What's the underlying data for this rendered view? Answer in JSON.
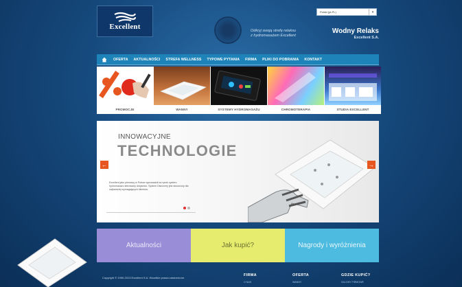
{
  "logo": {
    "text": "Excellent"
  },
  "language_select": {
    "value": "Polski (pl-PL)"
  },
  "tagline": {
    "line1": "Odkryj swoją strefę relaksu",
    "line2": "z hydromasażem Excellent"
  },
  "brand": {
    "title": "Wodny Relaks",
    "subtitle": "Excellent S.A."
  },
  "nav": {
    "items": [
      "OFERTA",
      "AKTUALNOŚCI",
      "STREFA WELLNESS",
      "TYPOWE PYTANIA",
      "FIRMA",
      "PLIKI DO POBRANIA",
      "KONTAKT"
    ]
  },
  "tiles": [
    {
      "label": "PROMOCJE"
    },
    {
      "label": "WANNY"
    },
    {
      "label": "SYSTEMY HYDROMASAŻU"
    },
    {
      "label": "CHROMOTERAPIA"
    },
    {
      "label": "STUDIA EXCELLENT"
    }
  ],
  "hero": {
    "kicker": "INNOWACYJNE",
    "headline": "TECHNOLOGIE",
    "description": "Excellent jako pierwszy w Polsce wprowadził na rynek system hydromasażu sterowany dotykowo. System Discovery jest stworzony dla najbardziej wymagających klientów."
  },
  "boxes": {
    "news": "Aktualności",
    "buy": "Jak kupić?",
    "awards": "Nagrody i wyróżnienia"
  },
  "footer": {
    "copyright": "Copyright © 1990-2013 Excellent S.A. Wszelkie prawa zastrzeżone.",
    "col1": {
      "head": "FIRMA",
      "sub": "O NAS"
    },
    "col2": {
      "head": "OFERTA",
      "sub": "WANNY"
    },
    "col3": {
      "head": "GDZIE KUPIĆ?",
      "sub": "SALONY FIRMOWE"
    }
  },
  "colors": {
    "nav": "#1d83b8",
    "arrow": "#e8561f",
    "box_news": "#9a8dd7",
    "box_buy": "#e6ec6e",
    "box_awards": "#4dbbe0"
  }
}
